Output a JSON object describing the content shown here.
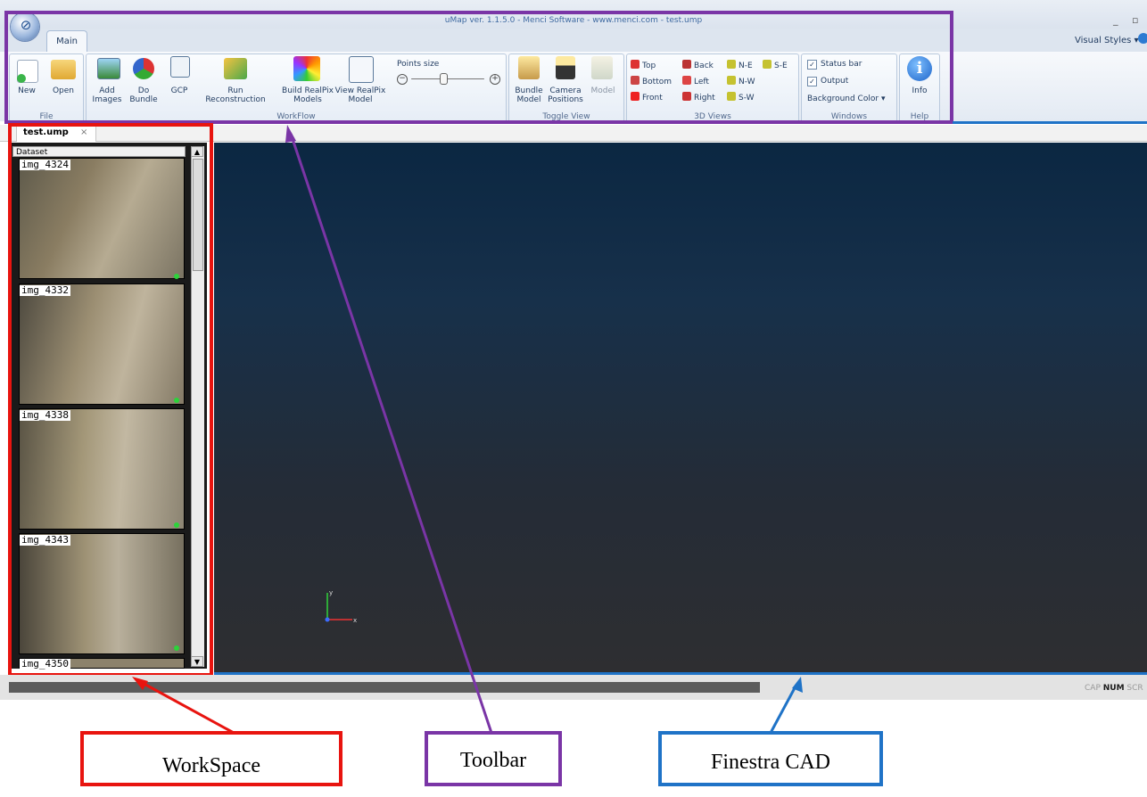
{
  "window": {
    "title": "uMap ver. 1.1.5.0 - Menci Software - www.menci.com  - test.ump",
    "controls": "_ ▫ ×",
    "visual_styles": "Visual Styles",
    "visual_styles_caret": "▾"
  },
  "ribbon": {
    "tab": "Main",
    "groups": {
      "file": {
        "label": "File",
        "new": "New",
        "open": "Open"
      },
      "workflow": {
        "label": "WorkFlow",
        "add_images": [
          "Add",
          "Images"
        ],
        "do_bundle": [
          "Do",
          "Bundle"
        ],
        "gcp": "GCP",
        "run_reconstruction": [
          "Run",
          "Reconstruction"
        ],
        "build_realpix": [
          "Build RealPix",
          "Models"
        ],
        "view_realpix": [
          "View RealPix",
          "Model"
        ],
        "points_size": "Points size"
      },
      "toggle_view": {
        "label": "Toggle View",
        "bundle_model": [
          "Bundle",
          "Model"
        ],
        "camera_positions": [
          "Camera",
          "Positions"
        ],
        "model": "Model"
      },
      "views_3d": {
        "label": "3D Views",
        "top": "Top",
        "bottom": "Bottom",
        "front": "Front",
        "back": "Back",
        "left": "Left",
        "right": "Right",
        "ne": "N-E",
        "nw": "N-W",
        "sw": "S-W",
        "se": "S-E"
      },
      "windows": {
        "label": "Windows",
        "status_bar": "Status bar",
        "output": "Output",
        "background_color": "Background Color",
        "status_bar_checked": true,
        "output_checked": true
      },
      "help": {
        "label": "Help",
        "info": "Info"
      }
    }
  },
  "document_tab": {
    "label": "test.ump",
    "close": "×"
  },
  "workspace": {
    "header": "Dataset",
    "scroll_up": "▲",
    "scroll_down": "▼",
    "images": [
      "img_4324",
      "img_4332",
      "img_4338",
      "img_4343",
      "img_4350"
    ]
  },
  "cad": {
    "axis_x": "x",
    "axis_y": "y"
  },
  "status": {
    "cap": "CAP",
    "num": "NUM",
    "scr": "SCR"
  },
  "annotations": {
    "workspace": "WorkSpace",
    "toolbar": "Toolbar",
    "cad_window": "Finestra CAD"
  },
  "colors": {
    "workspace_annotation": "#e8140f",
    "toolbar_annotation": "#7a35a6",
    "cad_annotation": "#1f73c7",
    "viewport_top": "#0b2742",
    "viewport_bottom": "#2e2e31",
    "image_ok_dot": "#2cd33a"
  }
}
